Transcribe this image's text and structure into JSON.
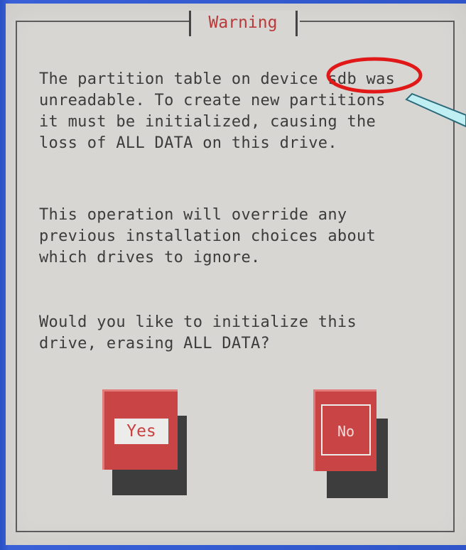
{
  "dialog": {
    "title": "Warning",
    "message_1": "The partition table on device sdb was\nunreadable. To create new partitions\nit must be initialized, causing the\nloss of ALL DATA on this drive.",
    "message_2": "This operation will override any\nprevious installation choices about\nwhich drives to ignore.",
    "message_3": "Would you like to initialize this\ndrive, erasing ALL DATA?",
    "yes_label": "Yes",
    "no_label": "No"
  },
  "annotation": {
    "highlight_color": "#e01818",
    "callout_color": "#bfeff3",
    "callout_stroke": "#2a6a7a"
  }
}
